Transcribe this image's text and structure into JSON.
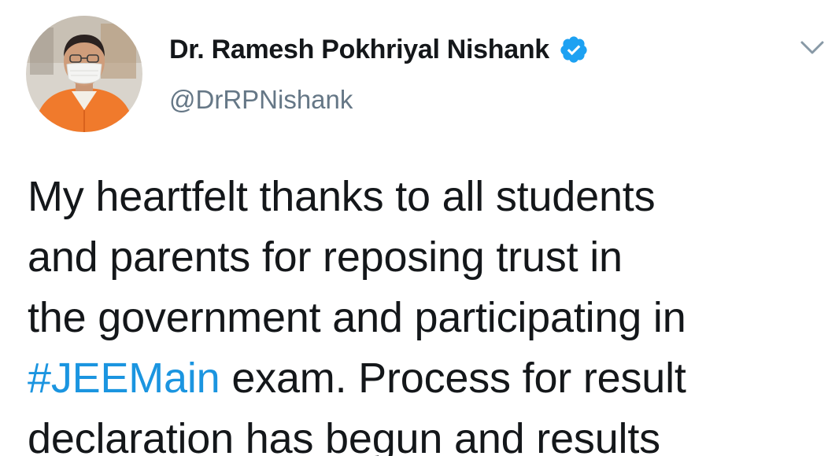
{
  "author": {
    "display_name": "Dr. Ramesh Pokhriyal Nishank",
    "handle": "@DrRPNishank",
    "verified": true,
    "avatar_icon": "profile-photo"
  },
  "menu": {
    "icon": "chevron-down-icon"
  },
  "tweet": {
    "line1": "My heartfelt thanks to all students",
    "line2": "and parents for reposing trust in",
    "line3": "the government and participating in",
    "hashtag": "#JEEMain",
    "line4_rest": " exam. Process for result",
    "line5": "declaration has begun and results"
  },
  "colors": {
    "link": "#1b95e0",
    "verified": "#1da1f2",
    "secondary_text": "#657786",
    "primary_text": "#14171a"
  }
}
